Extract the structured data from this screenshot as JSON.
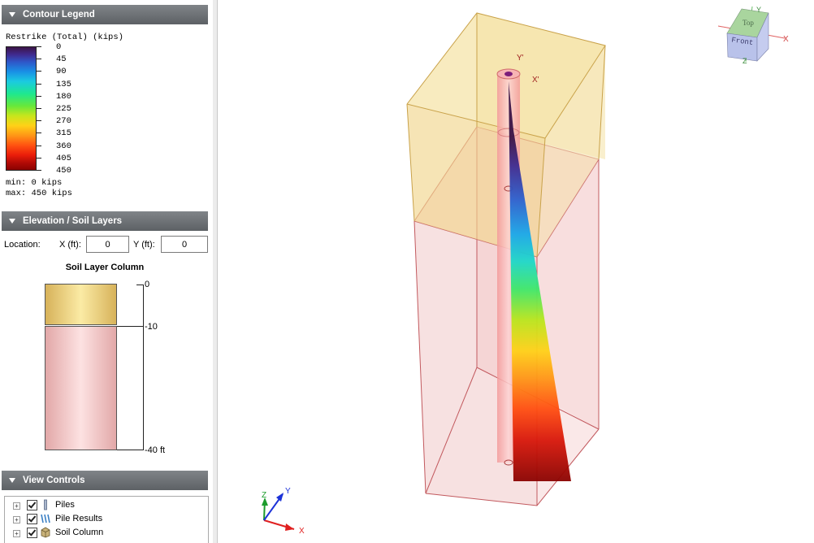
{
  "contour_legend": {
    "header": "Contour Legend",
    "title": "Restrike (Total) (kips)",
    "ticks": [
      "0",
      "45",
      "90",
      "135",
      "180",
      "225",
      "270",
      "315",
      "360",
      "405",
      "450"
    ],
    "min": "min: 0 kips",
    "max": "max: 450 kips"
  },
  "elevation": {
    "header": "Elevation / Soil Layers",
    "location_label": "Location:",
    "x_label": "X (ft):",
    "x_value": "0",
    "y_label": "Y (ft):",
    "y_value": "0",
    "column_title": "Soil Layer Column",
    "levels": [
      "0",
      "-10",
      "-40 ft"
    ],
    "layer_colors": [
      "#f2d98a",
      "#f4c7c7"
    ]
  },
  "view_controls": {
    "header": "View Controls",
    "items": [
      {
        "label": "Piles",
        "checked": true,
        "icon": "pile-icon"
      },
      {
        "label": "Pile Results",
        "checked": true,
        "icon": "pile-results-icon"
      },
      {
        "label": "Soil Column",
        "checked": true,
        "icon": "soil-column-icon"
      }
    ]
  },
  "viewport": {
    "pile_labels": {
      "y": "Y'",
      "x": "X'"
    },
    "view_cube": {
      "top": "Top",
      "front": "Front",
      "x": "X",
      "y": "Y",
      "z": "Z"
    },
    "triad": {
      "x": "X",
      "y": "Y",
      "z": "Z"
    },
    "colors": {
      "upper_soil": "#f0d890",
      "lower_soil": "#f5d0d0",
      "pile": "#f5a0a0",
      "edge": "#c25a5a"
    }
  }
}
